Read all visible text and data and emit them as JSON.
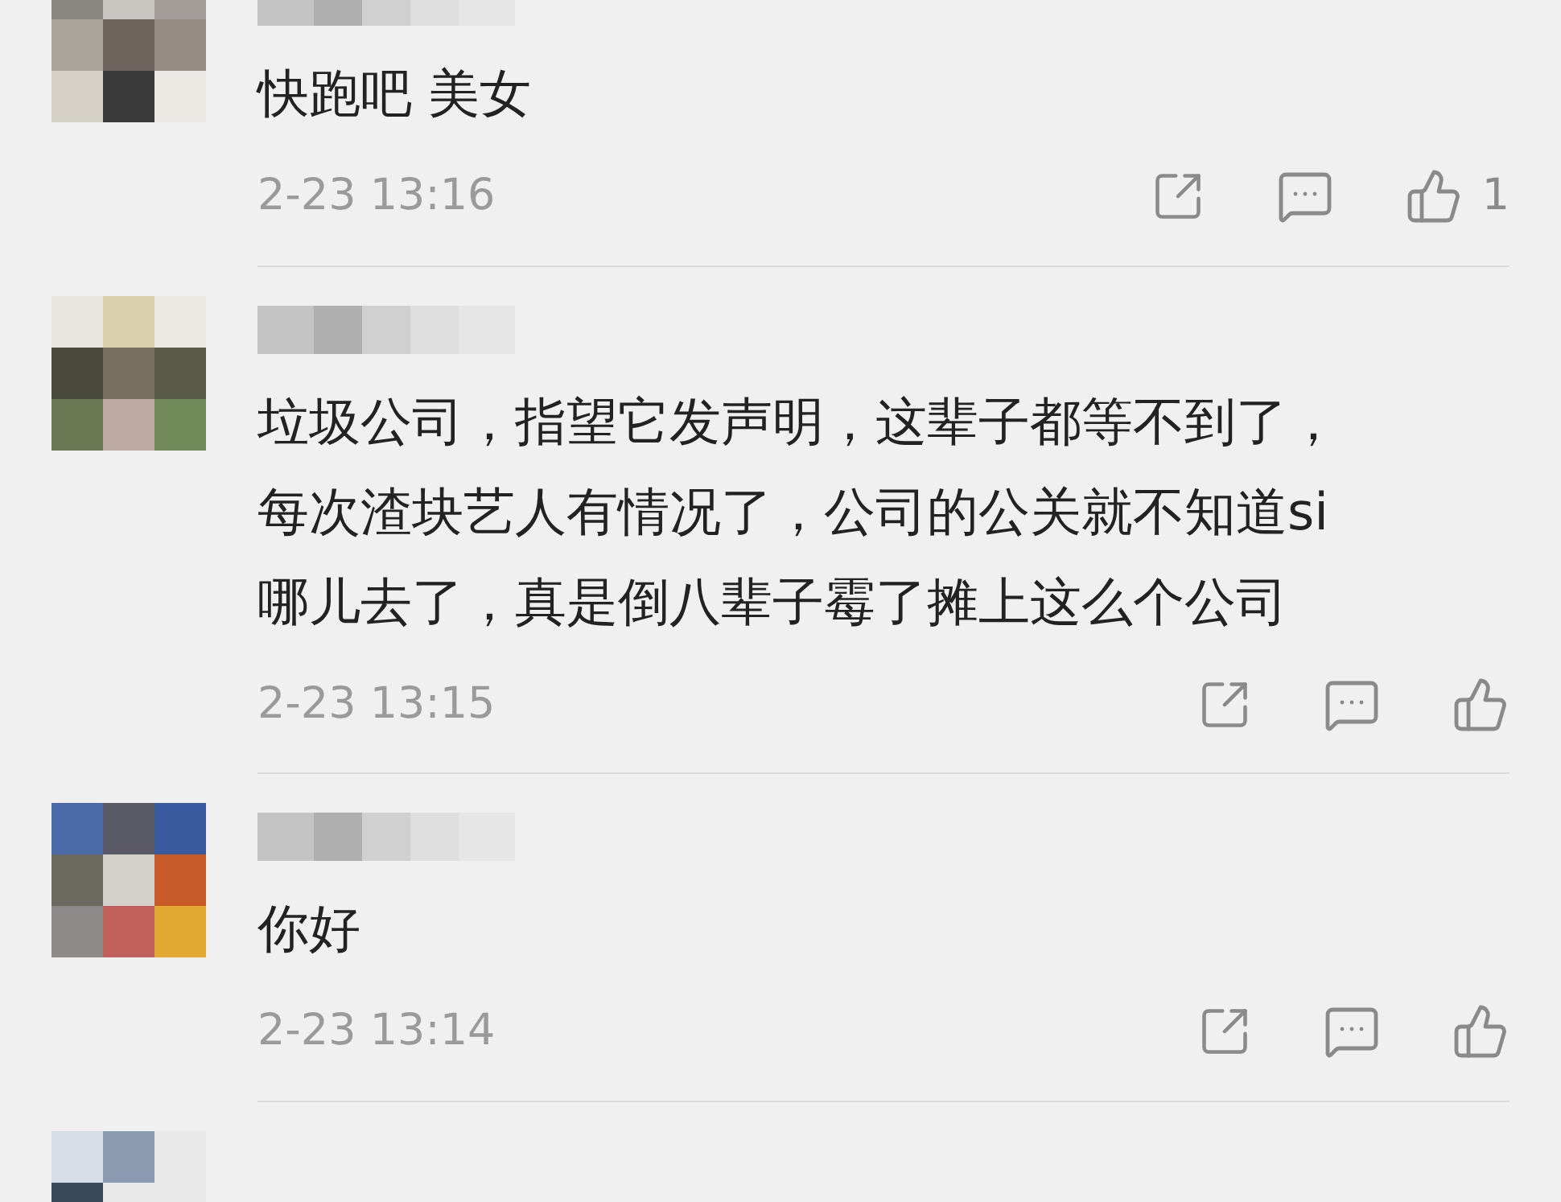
{
  "comments": [
    {
      "lines": [
        "快跑吧 美女"
      ],
      "time": "2-23 13:16",
      "likes": "1"
    },
    {
      "lines": [
        "垃圾公司，指望它发声明，这辈子都等不到了，",
        "每次渣块艺人有情况了，公司的公关就不知道si",
        "哪儿去了，真是倒八辈子霉了摊上这么个公司"
      ],
      "time": "2-23 13:15"
    },
    {
      "lines": [
        "你好"
      ],
      "time": "2-23 13:14"
    }
  ],
  "next_comment_partial": true
}
